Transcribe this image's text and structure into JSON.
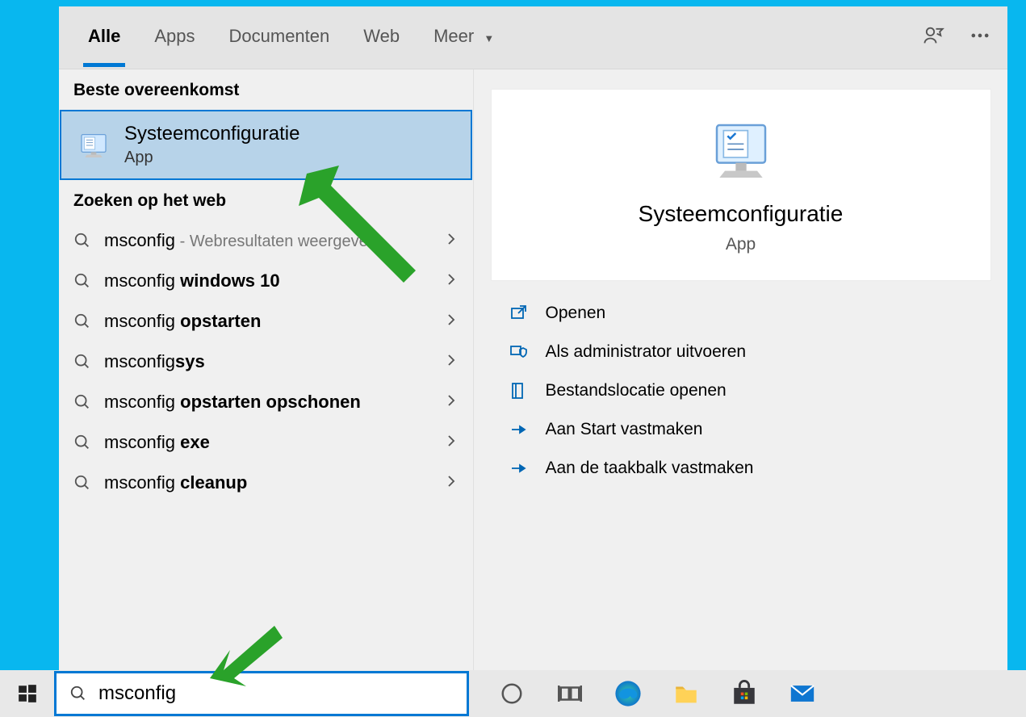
{
  "tabs": {
    "all": "Alle",
    "apps": "Apps",
    "documents": "Documenten",
    "web": "Web",
    "more": "Meer"
  },
  "section": {
    "best_match": "Beste overeenkomst",
    "web_search": "Zoeken op het web"
  },
  "best_match": {
    "title": "Systeemconfiguratie",
    "subtitle": "App"
  },
  "web_results": [
    {
      "prefix": "msconfig",
      "bold": "",
      "suffix": " - Webresultaten weergeven"
    },
    {
      "prefix": "msconfig ",
      "bold": "windows 10",
      "suffix": ""
    },
    {
      "prefix": "msconfig ",
      "bold": "opstarten",
      "suffix": ""
    },
    {
      "prefix": "msconfig",
      "bold": "sys",
      "suffix": ""
    },
    {
      "prefix": "msconfig ",
      "bold": "opstarten opschonen",
      "suffix": ""
    },
    {
      "prefix": "msconfig ",
      "bold": "exe",
      "suffix": ""
    },
    {
      "prefix": "msconfig ",
      "bold": "cleanup",
      "suffix": ""
    }
  ],
  "detail": {
    "title": "Systeemconfiguratie",
    "subtitle": "App"
  },
  "actions": {
    "open": "Openen",
    "run_admin": "Als administrator uitvoeren",
    "open_location": "Bestandslocatie openen",
    "pin_start": "Aan Start vastmaken",
    "pin_taskbar": "Aan de taakbalk vastmaken"
  },
  "search": {
    "value": "msconfig",
    "placeholder": ""
  }
}
